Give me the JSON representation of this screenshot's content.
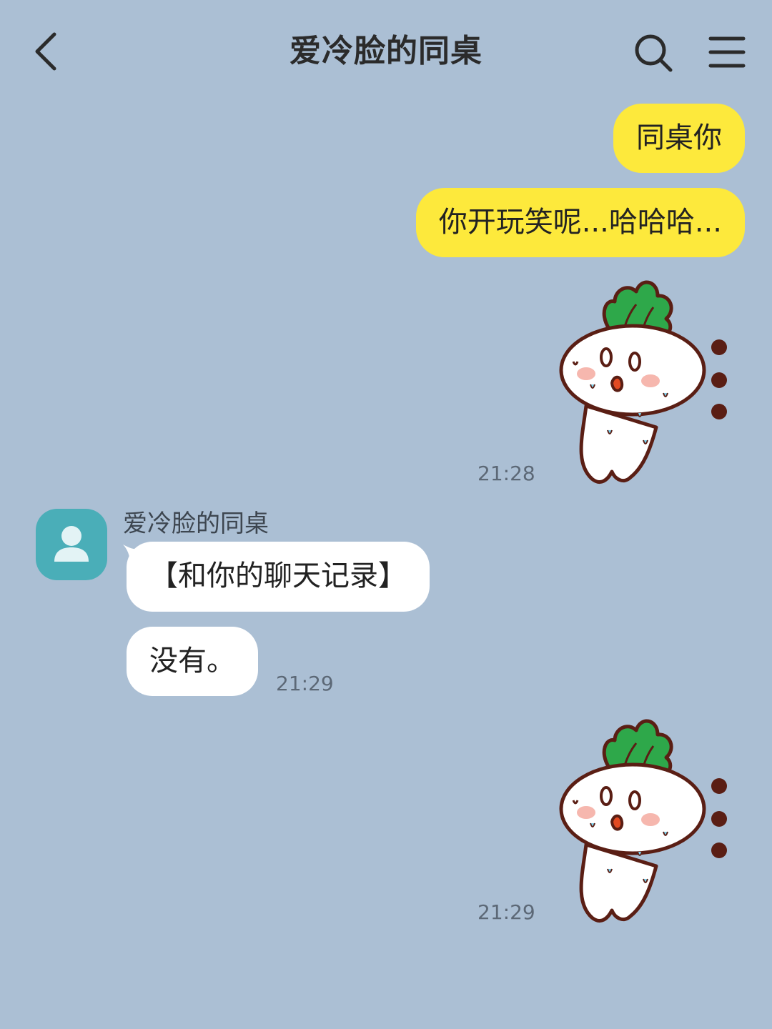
{
  "header": {
    "title": "爱冷脸的同桌",
    "back_icon": "chevron-left-icon",
    "search_icon": "search-icon",
    "menu_icon": "menu-icon"
  },
  "messages": {
    "outgoing_1": "同桌你",
    "outgoing_2": "你开玩笑呢...哈哈哈...",
    "outgoing_sticker_1": {
      "icon": "crying-radish-sticker",
      "time": "21:28"
    },
    "incoming_sender": "爱冷脸的同桌",
    "incoming_1": "【和你的聊天记录】",
    "incoming_2": "没有。",
    "incoming_time": "21:29",
    "outgoing_sticker_2": {
      "icon": "crying-radish-sticker",
      "time": "21:29"
    }
  },
  "colors": {
    "background": "#abbfd4",
    "outgoing_bubble": "#fde93c",
    "incoming_bubble": "#ffffff",
    "avatar": "#4aaeb8"
  }
}
